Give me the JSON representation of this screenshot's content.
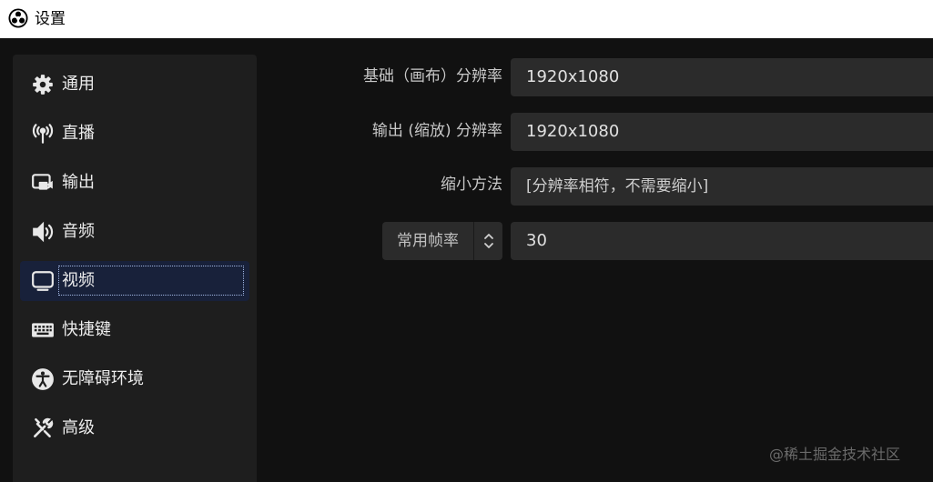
{
  "window": {
    "title": "设置"
  },
  "sidebar": {
    "items": [
      {
        "label": "通用",
        "icon": "gear-icon"
      },
      {
        "label": "直播",
        "icon": "broadcast-antenna-icon"
      },
      {
        "label": "输出",
        "icon": "output-camera-icon"
      },
      {
        "label": "音频",
        "icon": "speaker-icon"
      },
      {
        "label": "视频",
        "icon": "monitor-icon",
        "selected": true
      },
      {
        "label": "快捷键",
        "icon": "keyboard-icon"
      },
      {
        "label": "无障碍环境",
        "icon": "accessibility-icon"
      },
      {
        "label": "高级",
        "icon": "tools-icon"
      }
    ]
  },
  "video": {
    "base_resolution": {
      "label": "基础（画布）分辨率",
      "value": "1920x1080"
    },
    "output_resolution": {
      "label": "输出 (缩放) 分辨率",
      "value": "1920x1080"
    },
    "downscale_filter": {
      "label": "缩小方法",
      "value": "[分辨率相符，不需要缩小]"
    },
    "fps": {
      "type_label": "常用帧率",
      "value": "30"
    }
  },
  "watermark": "@稀土掘金技术社区",
  "colors": {
    "selected_bg": "#18213a",
    "panel_bg": "#1e1e1e",
    "field_bg": "#2b2b2b",
    "window_bg": "#111111"
  }
}
